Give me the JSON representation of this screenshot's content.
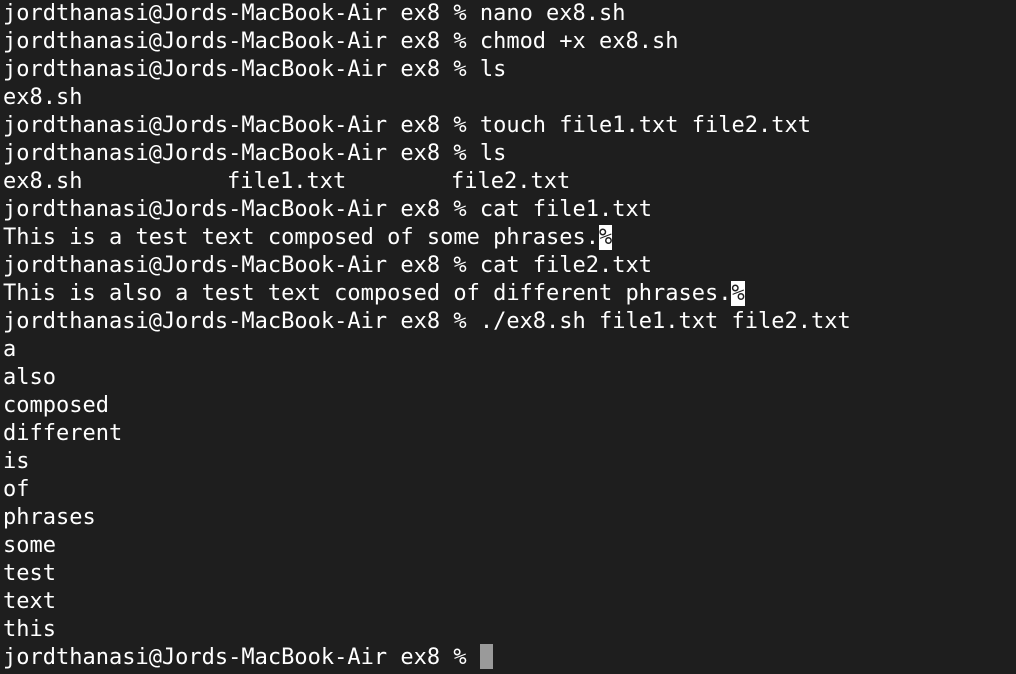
{
  "prompt": "jordthanasi@Jords-MacBook-Air ex8 % ",
  "eol_marker": "%",
  "lines": {
    "l0": "nano ex8.sh",
    "l1": "chmod +x ex8.sh",
    "l2": "ls",
    "l3": "ex8.sh",
    "l4": "touch file1.txt file2.txt",
    "l5": "ls",
    "l6": [
      "ex8.sh",
      "file1.txt",
      "file2.txt"
    ],
    "l7": "cat file1.txt",
    "l8": "This is a test text composed of some phrases.",
    "l9": "cat file2.txt",
    "l10": "This is also a test text composed of different phrases.",
    "l11": "./ex8.sh file1.txt file2.txt"
  },
  "output_words": [
    "a",
    "also",
    "composed",
    "different",
    "is",
    "of",
    "phrases",
    "some",
    "test",
    "text",
    "this"
  ]
}
